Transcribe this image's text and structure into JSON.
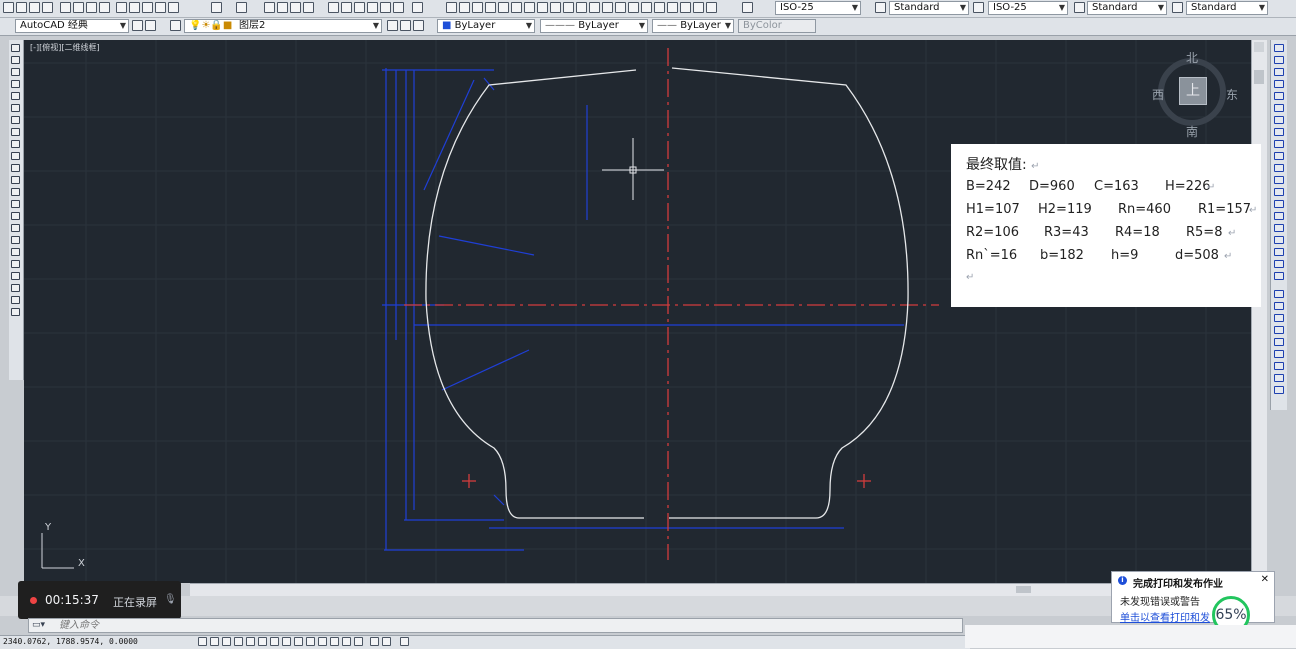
{
  "toolbar1": {
    "dims_style_1": "ISO-25",
    "text_style_1": "Standard",
    "dims_style_2": "ISO-25",
    "table_style": "Standard",
    "multileader_style": "Standard"
  },
  "toolbar2": {
    "workspace": "AutoCAD 经典",
    "layer": "图层2",
    "color": "ByLayer",
    "linetype": "ByLayer",
    "lineweight": "ByLayer",
    "plotstyle": "ByColor"
  },
  "viewport": {
    "label": "[-][俯视][二维线框]"
  },
  "viewcube": {
    "top": "上",
    "north": "北",
    "south": "南",
    "east": "东",
    "west": "西"
  },
  "ucs": {
    "x_label": "X",
    "y_label": "Y"
  },
  "panel": {
    "title": "最终取值:",
    "rows": [
      [
        "B=242",
        "D=960",
        "C=163",
        "H=226"
      ],
      [
        "H1=107",
        "H2=119",
        "Rn=460",
        "R1=157"
      ],
      [
        "R2=106",
        "R3=43",
        "R4=18",
        "R5=8"
      ],
      [
        "Rn`=16",
        "b=182",
        "h=9",
        "d=508"
      ]
    ],
    "return_mark": "↵"
  },
  "recording": {
    "time": "00:15:37",
    "status": "正在录屏"
  },
  "command": {
    "placeholder": "键入命令"
  },
  "statusbar": {
    "coords": "2340.0762, 1788.9574, 0.0000"
  },
  "notification": {
    "title": "完成打印和发布作业",
    "line1": "未发现错误或警告",
    "line2": "单击以查看打印和发布...",
    "progress": "65%"
  },
  "colors": {
    "canvas": "#212830",
    "dimension": "#1f3fd6",
    "centerline": "#d23c3c",
    "profile": "#e6e8ea"
  }
}
